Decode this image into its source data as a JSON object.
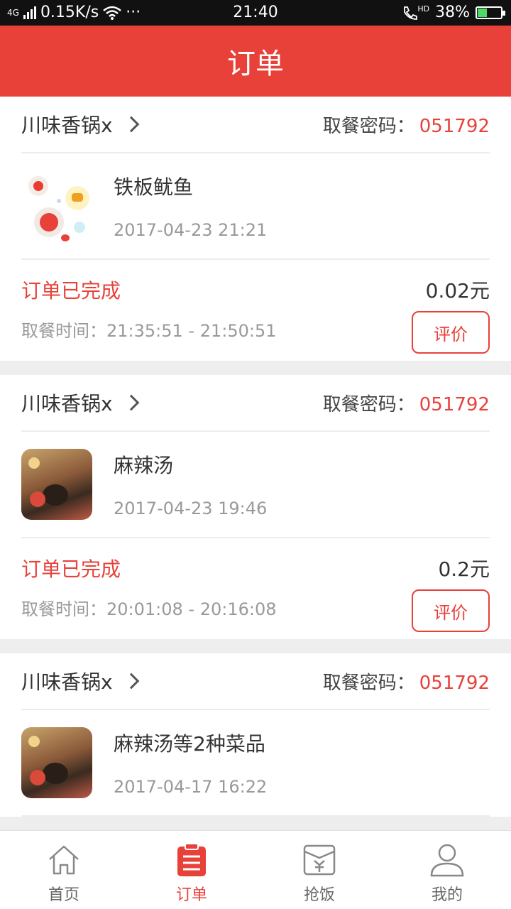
{
  "status_bar": {
    "network": "4G",
    "speed": "0.15K/s",
    "more": "···",
    "time": "21:40",
    "call_label": "HD",
    "battery": "38%",
    "battery_level": 0.38
  },
  "header": {
    "title": "订单"
  },
  "orders": [
    {
      "store": "川味香锅x",
      "code_label": "取餐密码：",
      "code": "051792",
      "item_name": "铁板鱿鱼",
      "order_time": "2017-04-23 21:21",
      "status": "订单已完成",
      "pickup_label": "取餐时间：",
      "pickup_time": "21:35:51 - 21:50:51",
      "price": "0.02元",
      "rate_label": "评价",
      "thumb_icon": "food-icons-icon"
    },
    {
      "store": "川味香锅x",
      "code_label": "取餐密码：",
      "code": "051792",
      "item_name": "麻辣汤",
      "order_time": "2017-04-23 19:46",
      "status": "订单已完成",
      "pickup_label": "取餐时间：",
      "pickup_time": "20:01:08 - 20:16:08",
      "price": "0.2元",
      "rate_label": "评价",
      "thumb_icon": "restaurant-scene-icon"
    },
    {
      "store": "川味香锅x",
      "code_label": "取餐密码：",
      "code": "051792",
      "item_name": "麻辣汤等2种菜品",
      "order_time": "2017-04-17 16:22",
      "thumb_icon": "restaurant-scene-icon"
    }
  ],
  "tabbar": {
    "items": [
      {
        "label": "首页",
        "icon": "home-icon",
        "active": false
      },
      {
        "label": "订单",
        "icon": "order-list-icon",
        "active": true
      },
      {
        "label": "抢饭",
        "icon": "grab-meal-icon",
        "active": false
      },
      {
        "label": "我的",
        "icon": "profile-icon",
        "active": false
      }
    ]
  },
  "colors": {
    "accent": "#e8413a",
    "text": "#333333",
    "muted": "#999999"
  }
}
